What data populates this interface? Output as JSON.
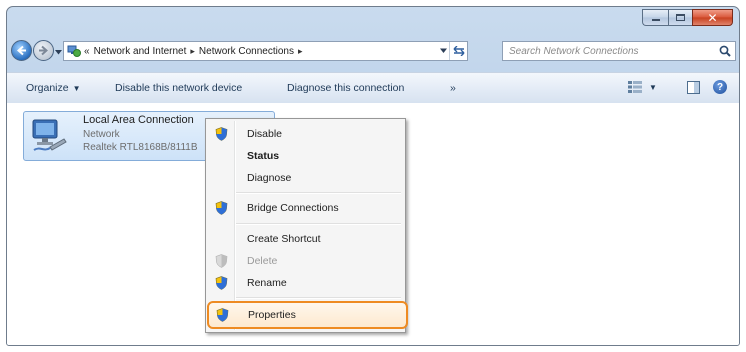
{
  "window": {
    "caption_buttons": [
      "minimize",
      "maximize",
      "close"
    ]
  },
  "address_bar": {
    "prefix": "«",
    "crumbs": [
      "Network and Internet",
      "Network Connections"
    ],
    "separator": "▸",
    "search_placeholder": "Search Network Connections"
  },
  "command_bar": {
    "organize": "Organize",
    "disable_device": "Disable this network device",
    "diagnose": "Diagnose this connection",
    "more": "»",
    "help": "?"
  },
  "connection": {
    "name": "Local Area Connection",
    "status": "Network",
    "device": "Realtek RTL8168B/8111B"
  },
  "context_menu": {
    "items": [
      {
        "label": "Disable",
        "icon": "shield-icon"
      },
      {
        "label": "Status",
        "bold": true
      },
      {
        "label": "Diagnose"
      },
      {
        "label": "Bridge Connections",
        "icon": "shield-icon"
      },
      {
        "label": "Create Shortcut"
      },
      {
        "label": "Delete",
        "icon": "shield-icon",
        "disabled": true
      },
      {
        "label": "Rename",
        "icon": "shield-icon"
      },
      {
        "label": "Properties",
        "icon": "shield-icon",
        "highlighted": true
      }
    ]
  },
  "colors": {
    "highlight_outline": "#ee8b22",
    "selection_fill": "#cde2f8"
  }
}
